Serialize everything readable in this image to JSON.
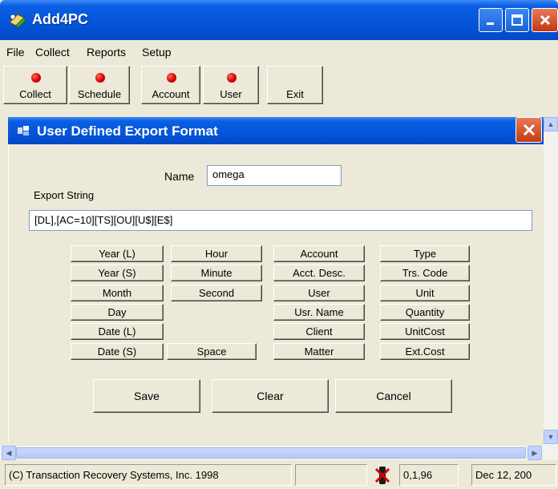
{
  "window": {
    "title": "Add4PC"
  },
  "menu": [
    "File",
    "Collect",
    "Reports",
    "Setup"
  ],
  "toolbar": [
    "Collect",
    "Schedule",
    "Account",
    "User",
    "Exit"
  ],
  "dialog": {
    "title": "User Defined Export Format",
    "name_label": "Name",
    "name_value": "omega",
    "export_string_label": "Export String",
    "export_string_value": "[DL],[AC=10][TS][OU][U$][E$]",
    "tokens": {
      "col1": [
        "Year (L)",
        "Year (S)",
        "Month",
        "Day",
        "Date (L)",
        "Date (S)"
      ],
      "col2": [
        "Hour",
        "Minute",
        "Second",
        "Space"
      ],
      "col3": [
        "Account",
        "Acct. Desc.",
        "User",
        "Usr. Name",
        "Client",
        "Matter"
      ],
      "col4": [
        "Type",
        "Trs. Code",
        "Unit",
        "Quantity",
        "UnitCost",
        "Ext.Cost"
      ]
    },
    "actions": {
      "save": "Save",
      "clear": "Clear",
      "cancel": "Cancel"
    }
  },
  "status": {
    "copyright": "(C) Transaction Recovery Systems, Inc. 1998",
    "version": "0,1,96",
    "date": "Dec 12, 200"
  },
  "colors": {
    "titlebar": "#0454d9",
    "close": "#c23a10",
    "dot": "#d40000"
  }
}
